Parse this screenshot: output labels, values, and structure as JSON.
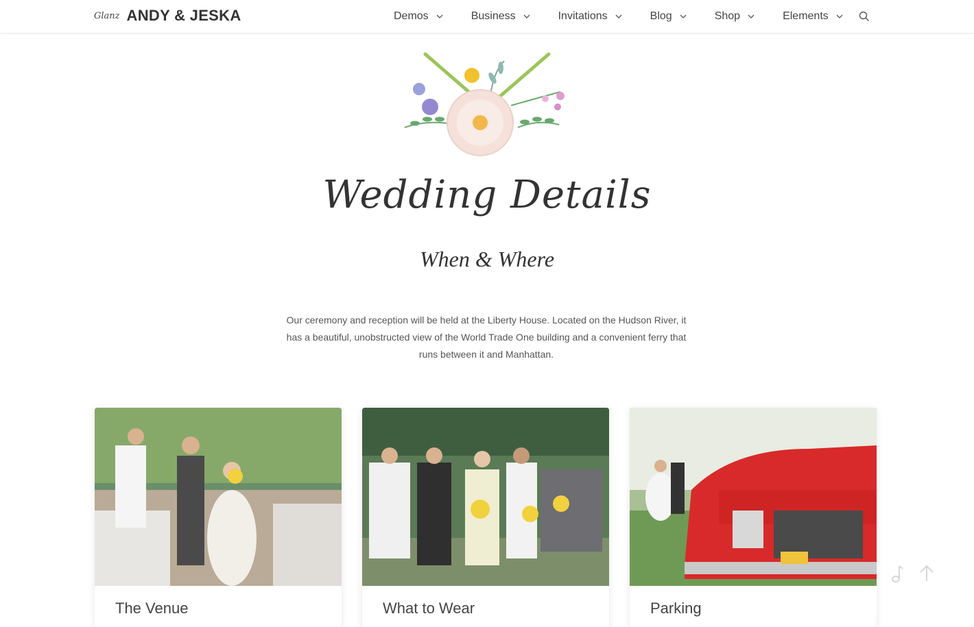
{
  "header": {
    "brand_script": "Glanz",
    "brand_name": "ANDY & JESKA",
    "nav": [
      {
        "label": "Demos"
      },
      {
        "label": "Business"
      },
      {
        "label": "Invitations"
      },
      {
        "label": "Blog"
      },
      {
        "label": "Shop"
      },
      {
        "label": "Elements"
      }
    ],
    "search_icon": "search-icon"
  },
  "hero": {
    "title": "Wedding Details",
    "subtitle": "When & Where",
    "intro": "Our ceremony and reception will be held at the Liberty House. Located on the Hudson River, it has a beautiful, unobstructed view of the World Trade One building and a convenient ferry that runs between it and Manhattan."
  },
  "cards": [
    {
      "title": "The Venue"
    },
    {
      "title": "What to Wear"
    },
    {
      "title": "Parking"
    }
  ],
  "floating": {
    "music_icon": "music-note-icon",
    "top_icon": "arrow-up-icon"
  },
  "colors": {
    "text": "#333333",
    "accent_green": "#9bc55a",
    "accent_yellow": "#f2c12e",
    "accent_pink": "#f6e1da"
  }
}
